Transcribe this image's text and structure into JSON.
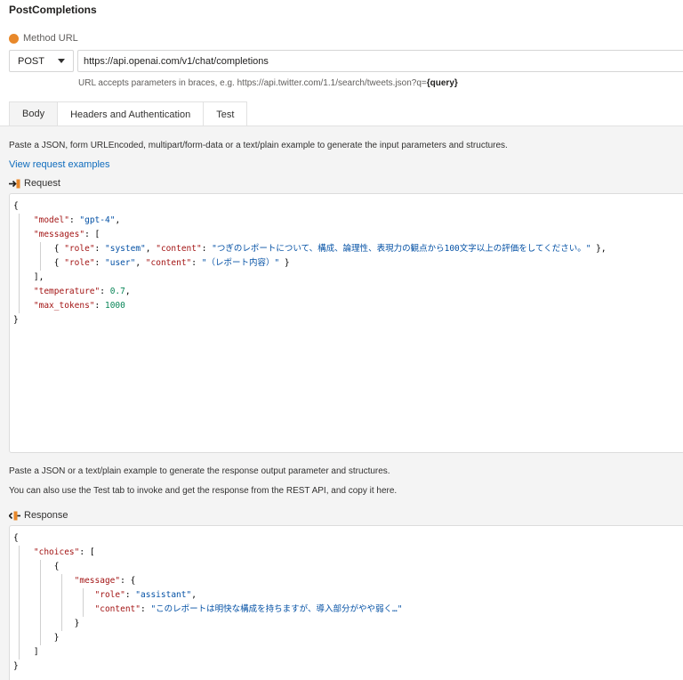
{
  "app": {
    "title": "PostCompletions"
  },
  "method_url": {
    "label": "Method URL",
    "method": "POST",
    "url": "https://api.openai.com/v1/chat/completions",
    "hint_prefix": "URL accepts parameters in braces, e.g. https://api.twitter.com/1.1/search/tweets.json?q=",
    "hint_param": "{query}",
    "status_color": "#e8882a"
  },
  "tabs": [
    {
      "label": "Body",
      "active": true
    },
    {
      "label": "Headers and Authentication",
      "active": false
    },
    {
      "label": "Test",
      "active": false
    }
  ],
  "body": {
    "request_instructions": "Paste a JSON, form URLEncoded, multipart/form-data or a text/plain example to generate the input parameters and structures.",
    "view_examples_link": "View request examples",
    "request_label": "Request",
    "request_lines": [
      {
        "open": "{"
      },
      {
        "key": "\"model\"",
        "sep": ": ",
        "str": "\"gpt-4\"",
        "tail": ","
      },
      {
        "key": "\"messages\"",
        "sep": ": ",
        "tail": "["
      },
      {
        "open": "{ ",
        "key": "\"role\"",
        "sep": ": ",
        "str": "\"system\"",
        "mid": ", ",
        "key2": "\"content\"",
        "sep2": ": ",
        "str2": "\"つぎのレポートについて、構成、論理性、表現力の観点から100文字以上の評価をしてください。\"",
        "tail": " },"
      },
      {
        "open": "{ ",
        "key": "\"role\"",
        "sep": ": ",
        "str": "\"user\"",
        "mid": ", ",
        "key2": "\"content\"",
        "sep2": ": ",
        "str2": "\"（レポート内容）\"",
        "tail": " }"
      },
      {
        "open": "],"
      },
      {
        "key": "\"temperature\"",
        "sep": ": ",
        "num": "0.7",
        "tail": ","
      },
      {
        "key": "\"max_tokens\"",
        "sep": ": ",
        "num": "1000"
      },
      {
        "open": "}"
      }
    ],
    "response_instructions_1": "Paste a JSON or a text/plain example to generate the response output parameter and structures.",
    "response_instructions_2": "You can also use the Test tab to invoke and get the response from the REST API, and copy it here.",
    "response_label": "Response",
    "response_lines": [
      {
        "open": "{"
      },
      {
        "key": "\"choices\"",
        "sep": ": ",
        "tail": "["
      },
      {
        "open": "{"
      },
      {
        "key": "\"message\"",
        "sep": ": ",
        "tail": "{"
      },
      {
        "key": "\"role\"",
        "sep": ": ",
        "str": "\"assistant\"",
        "tail": ","
      },
      {
        "key": "\"content\"",
        "sep": ": ",
        "str": "\"このレポートは明快な構成を持ちますが、導入部分がやや弱く…\""
      },
      {
        "open": "}"
      },
      {
        "open": "}"
      },
      {
        "open": "]"
      },
      {
        "open": "}"
      }
    ]
  }
}
